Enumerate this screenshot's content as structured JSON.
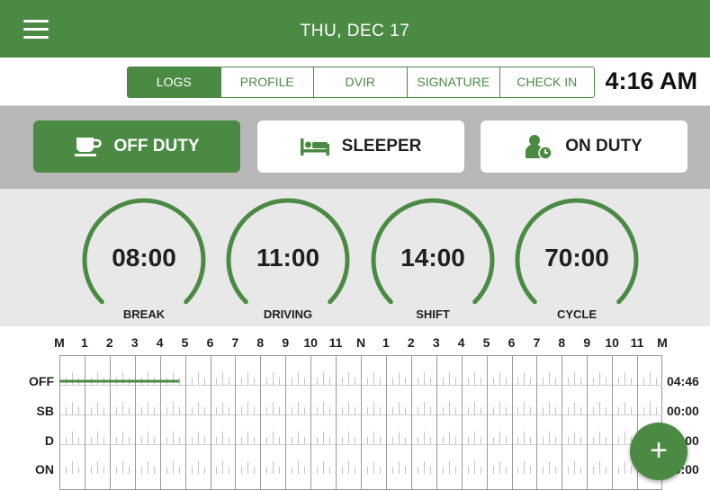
{
  "header": {
    "date": "THU, DEC  17",
    "menu_icon": "hamburger-menu-icon",
    "theme_icon": "moon-icon",
    "color": "#4a8a43"
  },
  "tabs": [
    {
      "label": "LOGS",
      "active": true
    },
    {
      "label": "PROFILE",
      "active": false
    },
    {
      "label": "DVIR",
      "active": false
    },
    {
      "label": "SIGNATURE",
      "active": false
    },
    {
      "label": "CHECK IN",
      "active": false
    }
  ],
  "time": "4:16 AM",
  "status_buttons": [
    {
      "label": "OFF DUTY",
      "icon": "coffee-cup-icon",
      "active": true
    },
    {
      "label": "SLEEPER",
      "icon": "bed-icon",
      "active": false
    },
    {
      "label": "ON DUTY",
      "icon": "driver-clock-icon",
      "active": false
    }
  ],
  "gauges": [
    {
      "value": "08:00",
      "label": "BREAK"
    },
    {
      "value": "11:00",
      "label": "DRIVING"
    },
    {
      "value": "14:00",
      "label": "SHIFT"
    },
    {
      "value": "70:00",
      "label": "CYCLE"
    }
  ],
  "log": {
    "hours": [
      "M",
      "1",
      "2",
      "3",
      "4",
      "5",
      "6",
      "7",
      "8",
      "9",
      "10",
      "11",
      "N",
      "1",
      "2",
      "3",
      "4",
      "5",
      "6",
      "7",
      "8",
      "9",
      "10",
      "11",
      "M"
    ],
    "rows": [
      {
        "label": "OFF",
        "total": "04:46"
      },
      {
        "label": "SB",
        "total": "00:00"
      },
      {
        "label": "D",
        "total": "00:00"
      },
      {
        "label": "ON",
        "total": "00:00"
      }
    ],
    "off_duty_until_hour": 4.77
  },
  "fab": {
    "label": "+",
    "icon": "add-icon"
  }
}
